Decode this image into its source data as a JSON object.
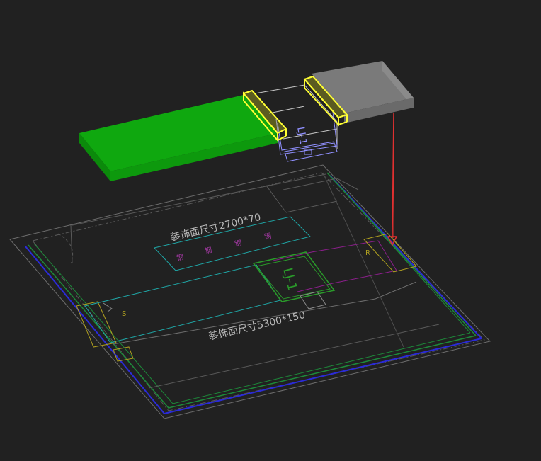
{
  "colors": {
    "background": "#212121",
    "green_block": "#0fa80f",
    "gray_block": "#7a7a7a",
    "yellow_bracket": "#ffff33",
    "red_arrow": "#e03030",
    "cyan_line": "#1fa6a6",
    "magenta_line": "#8c1f8c",
    "blue_line": "#2b2bd8",
    "green_line": "#1d8a3a",
    "gray_line": "#6d6d6d",
    "light_line": "#a8a8a8",
    "lavender_line": "#9090ff"
  },
  "labels": {
    "text_upper_dimension": "装饰面尺寸2700*70",
    "text_lower_dimension": "装饰面尺寸5300*150",
    "text_tag_floor": "LJ-1",
    "text_tag_3d": "LJ-1",
    "text_marker_s": "S",
    "text_marker_r": "R",
    "text_magenta_items": [
      "钢",
      "钢",
      "钢",
      "钢"
    ]
  }
}
